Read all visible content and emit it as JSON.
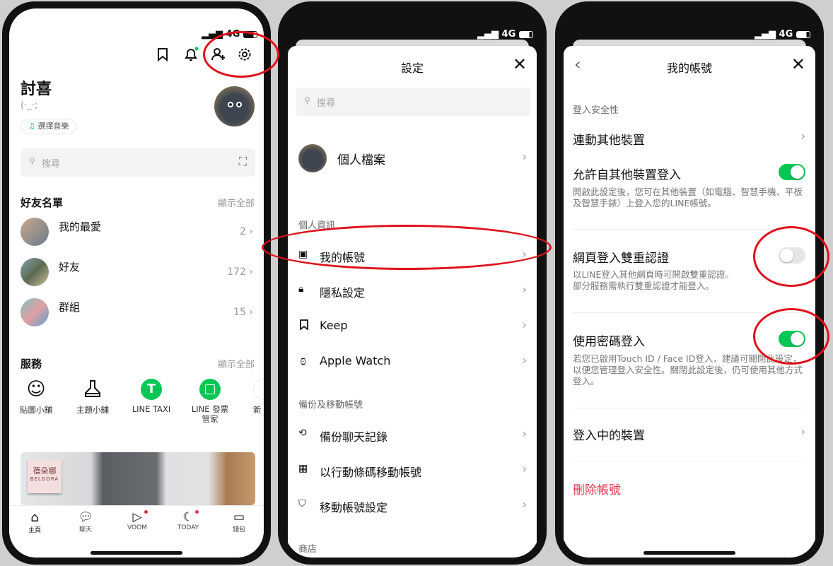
{
  "phone1": {
    "status": {
      "network": "4G"
    },
    "profile": {
      "name": "討喜",
      "status_message": "(·_·;",
      "music_button": "選擇音樂"
    },
    "search": {
      "placeholder": "搜尋"
    },
    "friends": {
      "title": "好友名單",
      "show_all": "顯示全部",
      "items": [
        {
          "label": "我的最愛",
          "count": "2"
        },
        {
          "label": "好友",
          "count": "172"
        },
        {
          "label": "群組",
          "count": "15"
        }
      ]
    },
    "services": {
      "title": "服務",
      "show_all": "顯示全部",
      "items": [
        {
          "label": "貼圖小舖",
          "icon": "smiley-icon"
        },
        {
          "label": "主題小舖",
          "icon": "brush-icon"
        },
        {
          "label": "LINE TAXI",
          "icon": "taxi-icon"
        },
        {
          "label": "LINE 發票\n管家",
          "icon": "receipt-icon"
        },
        {
          "label": "新",
          "icon": "more-icon"
        }
      ]
    },
    "banner": {
      "brand_cn": "蓓朵娜",
      "brand_en": "BELDORA"
    },
    "tabbar": [
      {
        "label": "主頁"
      },
      {
        "label": "聊天"
      },
      {
        "label": "VOOM"
      },
      {
        "label": "TODAY"
      },
      {
        "label": "錢包"
      }
    ],
    "colors": {
      "accent": "#06c755",
      "badge": "#e0354a"
    }
  },
  "phone2": {
    "status": {
      "network": "4G"
    },
    "title": "設定",
    "search": {
      "placeholder": "搜尋"
    },
    "profile_row": "個人檔案",
    "sections": [
      {
        "title": "個人資訊",
        "items": [
          "我的帳號",
          "隱私設定",
          "Keep",
          "Apple Watch"
        ]
      },
      {
        "title": "備份及移動帳號",
        "items": [
          "備份聊天記錄",
          "以行動條碼移動帳號",
          "移動帳號設定"
        ]
      },
      {
        "title": "商店",
        "items": []
      }
    ]
  },
  "phone3": {
    "status": {
      "network": "4G"
    },
    "title": "我的帳號",
    "section": "登入安全性",
    "link_devices": "連動其他裝置",
    "settings": [
      {
        "label": "允許自其他裝置登入",
        "desc": "開啟此設定後，您可在其他裝置（如電腦、智慧手機、平板及智慧手錶）上登入您的LINE帳號。",
        "enabled": true
      },
      {
        "label": "網頁登入雙重認證",
        "desc": "以LINE登入其他網頁時可開啟雙重認證。\n部分服務需執行雙重認證才能登入。",
        "enabled": false
      },
      {
        "label": "使用密碼登入",
        "desc": "若您已啟用Touch ID / Face ID登入，建議可關閉此設定，以便您管理登入安全性。關閉此設定後，仍可使用其他方式登入。",
        "enabled": true
      }
    ],
    "logged_in_devices": "登入中的裝置",
    "delete_account": "刪除帳號",
    "colors": {
      "toggle_on": "#06c755",
      "danger": "#e0354a"
    }
  }
}
